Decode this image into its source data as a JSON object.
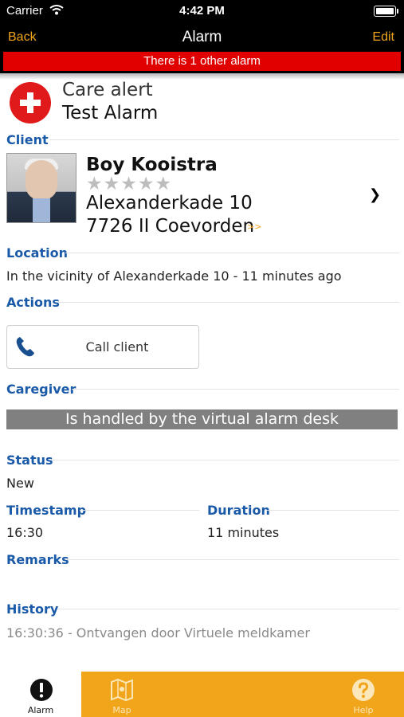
{
  "status_bar": {
    "carrier": "Carrier",
    "time": "4:42 PM"
  },
  "nav": {
    "back": "Back",
    "title": "Alarm",
    "edit": "Edit"
  },
  "banner": "There is 1 other alarm",
  "alert": {
    "type": "Care alert",
    "name": "Test Alarm"
  },
  "sections": {
    "client": "Client",
    "location": "Location",
    "actions": "Actions",
    "caregiver": "Caregiver",
    "status": "Status",
    "timestamp": "Timestamp",
    "duration": "Duration",
    "remarks": "Remarks",
    "history": "History"
  },
  "client": {
    "name": "Boy Kooistra",
    "rating_stars": "★★★★★",
    "rating": 0,
    "address_line1": "Alexanderkade 10",
    "address_line2": "7726 II Coevorden",
    "more": ">>"
  },
  "location_text": "In the vicinity of Alexanderkade 10 - 11 minutes ago",
  "actions": {
    "call_label": "Call client"
  },
  "caregiver_text": "Is handled by the virtual alarm desk",
  "status_value": "New",
  "timestamp_value": "16:30",
  "duration_value": "11 minutes",
  "history": [
    "16:30:36 - Ontvangen door Virtuele meldkamer"
  ],
  "tabs": [
    {
      "label": "Alarm",
      "icon": "alert-circle-icon",
      "active": true
    },
    {
      "label": "Map",
      "icon": "map-icon",
      "active": false
    },
    {
      "label": "Help",
      "icon": "help-icon",
      "active": false
    }
  ],
  "colors": {
    "accent": "#f0a51a",
    "alarm_red": "#e00000",
    "section_blue": "#1a5aa8",
    "caregiver_bar": "#808080"
  }
}
